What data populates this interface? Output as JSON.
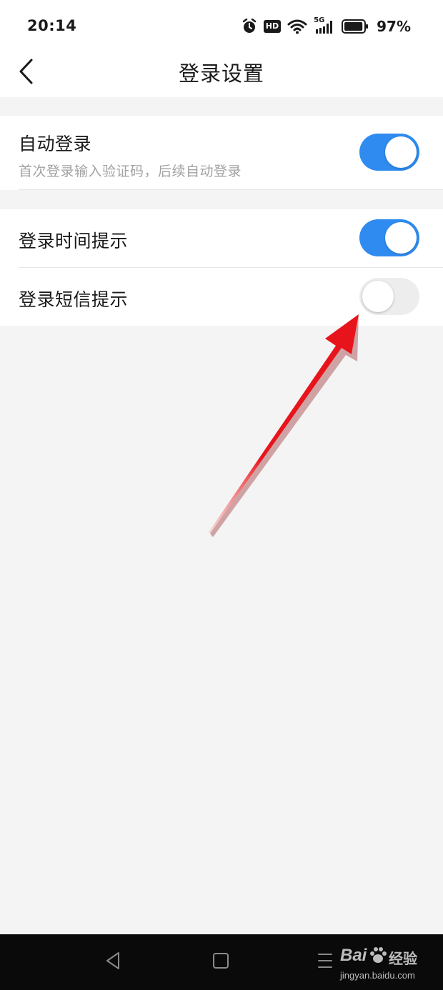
{
  "status_bar": {
    "time": "20:14",
    "icons": [
      "alarm-icon",
      "hd-icon",
      "wifi-icon",
      "5g-signal-icon",
      "battery-icon"
    ],
    "hd_label": "HD",
    "network_label": "5G",
    "battery": "97%",
    "battery_level": 0.97
  },
  "header": {
    "title": "登录设置",
    "back_icon": "chevron-left-icon"
  },
  "settings": {
    "auto_login": {
      "label": "自动登录",
      "subtitle": "首次登录输入验证码，后续自动登录",
      "enabled": true
    },
    "login_time_notice": {
      "label": "登录时间提示",
      "enabled": true
    },
    "login_sms_notice": {
      "label": "登录短信提示",
      "enabled": false
    }
  },
  "annotation": {
    "arrow_color": "#e8141b"
  },
  "system_nav": {
    "buttons": [
      "back-triangle-icon",
      "home-square-icon",
      "menu-lines-icon"
    ]
  },
  "watermark": {
    "brand": "Bai",
    "brand_suffix": "经验",
    "url": "jingyan.baidu.com"
  },
  "colors": {
    "accent": "#2f8bf0",
    "toggle_off": "#ededed",
    "background": "#f4f4f4"
  }
}
